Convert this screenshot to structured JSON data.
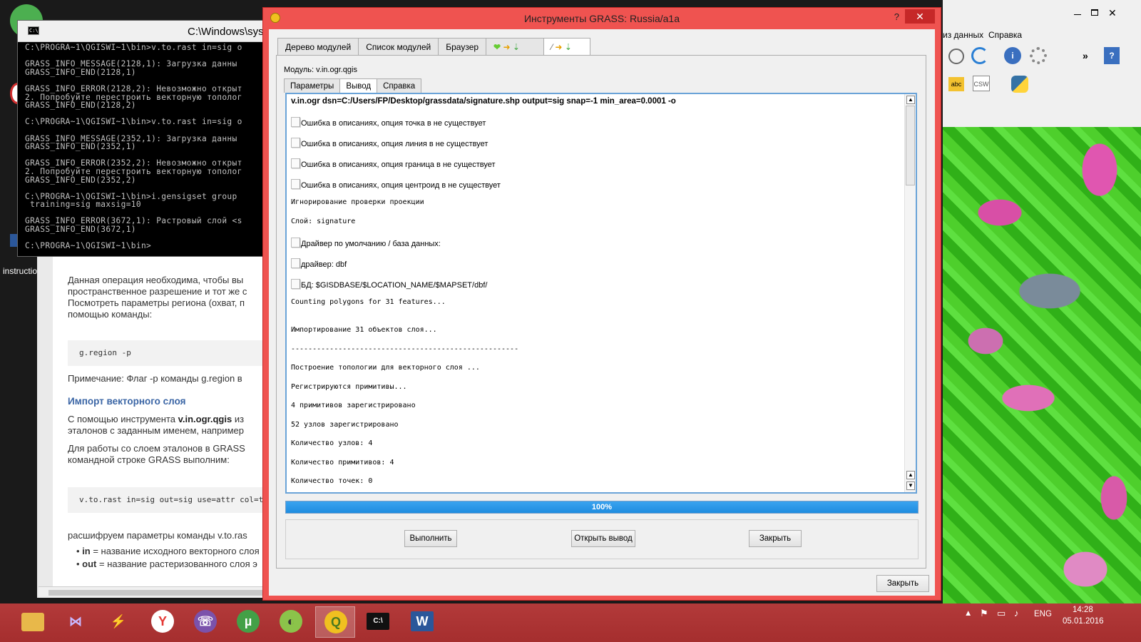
{
  "desktop": {
    "icon_label": "instructio"
  },
  "console": {
    "title": "C:\\Windows\\syste",
    "lines": "C:\\PROGRA~1\\QGISWI~1\\bin>v.to.rast in=sig o\n\nGRASS_INFO_MESSAGE(2128,1): Загрузка данны\nGRASS_INFO_END(2128,1)\n\nGRASS_INFO_ERROR(2128,2): Невозможно открыт\n2. Попробуйте перестроить векторную тополог\nGRASS_INFO_END(2128,2)\n\nC:\\PROGRA~1\\QGISWI~1\\bin>v.to.rast in=sig o\n\nGRASS_INFO_MESSAGE(2352,1): Загрузка данны\nGRASS_INFO_END(2352,1)\n\nGRASS_INFO_ERROR(2352,2): Невозможно открыт\n2. Попробуйте перестроить векторную тополог\nGRASS_INFO_END(2352,2)\n\nC:\\PROGRA~1\\QGISWI~1\\bin>i.gensigset group\n training=sig maxsig=10\n\nGRASS_INFO_ERROR(3672,1): Растровый слой <s\nGRASS_INFO_END(3672,1)\n\nC:\\PROGRA~1\\QGISWI~1\\bin>"
  },
  "doc": {
    "p1": [
      "Данная операция необходима, чтобы вы",
      "пространственное разрешение и тот же с",
      "Посмотреть параметры региона (охват, п",
      "помощью команды:"
    ],
    "code1": "g.region -p",
    "note": "Примечание: Флаг -p команды g.region в",
    "h_import": "Импорт векторного слоя",
    "p2a": "С помощью инструмента ",
    "p2b": "v.in.ogr.qgis",
    "p2c": " из",
    "p2d": "эталонов с заданным именем, например",
    "p3": [
      "Для работы со слоем эталонов в GRASS",
      "командной строке GRASS выполним:"
    ],
    "code2": "v.to.rast in=sig out=sig use=attr col=ty",
    "p4": "расшифруем параметры команды v.to.ras",
    "li1a": "in",
    "li1b": " = название исходного векторного слоя",
    "li2a": "out",
    "li2b": " = название растеризованного слоя э"
  },
  "qgis": {
    "menu_data": "из данных",
    "menu_help": "Справка",
    "csw_label": "CSW"
  },
  "dialog": {
    "title": "Инструменты GRASS: Russia/a1a",
    "help_mark": "?",
    "close_glyph": "✕",
    "tabs": [
      "Дерево модулей",
      "Список модулей",
      "Браузер"
    ],
    "module_label": "Модуль: v.in.ogr.qgis",
    "subtabs": [
      "Параметры",
      "Вывод",
      "Справка"
    ],
    "output": {
      "command": "v.in.ogr dsn=C:/Users/FP/Desktop/grassdata/signature.shp output=sig snap=-1 min_area=0.0001 -o",
      "warn_point": "Ошибка в описаниях, опция точка в не существует",
      "warn_line": "Ошибка в описаниях, опция линия в не существует",
      "warn_boundary": "Ошибка в описаниях, опция граница в не существует",
      "warn_centroid": "Ошибка в описаниях, опция центроид в не существует",
      "proj_skip": "Игнорирование проверки проекции",
      "layer": "Слой: signature",
      "default_driver": "Драйвер по умолчанию / база данных:",
      "driver": "драйвер: dbf",
      "db": "БД: $GISDBASE/$LOCATION_NAME/$MAPSET/dbf/",
      "counting": "Counting polygons for 31 features...",
      "importing": "Импортирование 31 объектов слоя...",
      "separator": "-----------------------------------------------------",
      "building": "Построение топологии для векторного слоя  ...",
      "registering": "Регистрируются примитивы...",
      "prims_registered": "4 примитивов зарегистрировано",
      "nodes_registered": "52 узлов зарегистрировано",
      "nodes_count": "Количество узлов: 4",
      "prims_count": "Количество примитивов: 4",
      "points_count": "Количество точек: 0"
    },
    "progress": {
      "text": "100%",
      "value": 1.0
    },
    "buttons": {
      "run": "Выполнить",
      "open_output": "Открыть вывод",
      "close": "Закрыть",
      "close_main": "Закрыть"
    }
  },
  "taskbar": {
    "lang": "ENG",
    "time": "14:28",
    "date": "05.01.2016"
  }
}
